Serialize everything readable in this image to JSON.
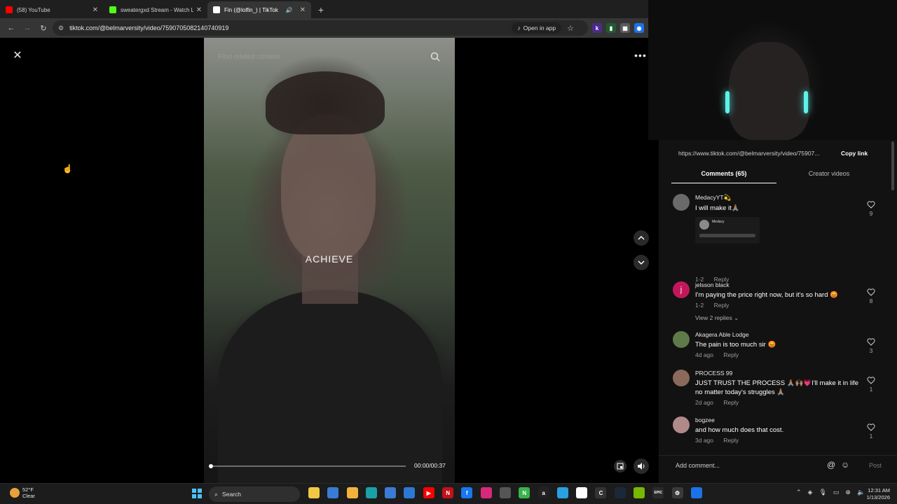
{
  "tabs": [
    {
      "title": "(58) YouTube",
      "close": "✕",
      "favicon_color": "#ff0000"
    },
    {
      "title": "sweatergxd Stream - Watch Live",
      "close": "✕",
      "favicon_color": "#53fc18"
    },
    {
      "title": "Fin (@lolfin_) | TikTok",
      "close": "✕",
      "favicon_color": "#ffffff",
      "active": true
    }
  ],
  "browser": {
    "url": "tiktok.com/@belmarversity/video/7590705082140740919",
    "open_in_app": "Open in app",
    "new_tab": "+",
    "back": "←",
    "forward": "→",
    "reload": "↻"
  },
  "video": {
    "search_placeholder": "Find related content",
    "caption": "ACHIEVE",
    "time": "00:00/00:37",
    "progress_fraction": 0.0,
    "close": "✕",
    "more": "•••"
  },
  "panel": {
    "link_url": "https://www.tiktok.com/@belmarversity/video/75907...",
    "copy_link": "Copy link",
    "tab_comments": "Comments (65)",
    "tab_creator": "Creator videos",
    "add_comment_placeholder": "Add comment...",
    "post": "Post",
    "reply_label": "Reply",
    "comments": [
      {
        "name": "MedacyYT💫",
        "text": "I will make it🙏🏽",
        "meta": "1-2",
        "likes": "9",
        "avatar_color": "#6a6a6a",
        "attachment_label": "Medacy"
      },
      {
        "name": "jelsson black",
        "text": "I'm paying the price right now, but it's so hard 😡",
        "meta": "1-2",
        "likes": "8",
        "avatar_color": "#c2185b",
        "avatar_letter": "j",
        "view_replies": "View 2 replies ⌄"
      },
      {
        "name": "Akagera Able Lodge",
        "text": "The pain is too much sir 😡",
        "meta": "4d ago",
        "likes": "3",
        "avatar_color": "#5e7a48"
      },
      {
        "name": "PROCESS 99",
        "text": "JUST TRUST THE PROCESS 🙏🏽🙌🏽💗I'll make it in life no matter today's struggles 🙏🏽",
        "meta": "2d ago",
        "likes": "1",
        "avatar_color": "#8a6a5a"
      },
      {
        "name": "bogzee",
        "text": "and how much does that cost.",
        "meta": "3d ago",
        "likes": "1",
        "avatar_color": "#b08a8a"
      }
    ]
  },
  "taskbar": {
    "temp": "52°F",
    "condition": "Clear",
    "search": "Search",
    "time": "12:31 AM",
    "date": "1/13/2026",
    "icons": [
      {
        "name": "file-explorer",
        "color": "#f2c744",
        "label": ""
      },
      {
        "name": "copilot",
        "color": "#3a7bd5",
        "label": ""
      },
      {
        "name": "folder",
        "color": "#f2b33d",
        "label": ""
      },
      {
        "name": "edge",
        "color": "#1aa0a8",
        "label": ""
      },
      {
        "name": "store",
        "color": "#3a7bd5",
        "label": ""
      },
      {
        "name": "outlook",
        "color": "#2c78d4",
        "label": ""
      },
      {
        "name": "youtube",
        "color": "#ff0000",
        "label": "▶"
      },
      {
        "name": "netflix",
        "color": "#c0121a",
        "label": "N"
      },
      {
        "name": "facebook",
        "color": "#1877f2",
        "label": "f"
      },
      {
        "name": "instagram",
        "color": "#d6297b",
        "label": ""
      },
      {
        "name": "calculator",
        "color": "#555555",
        "label": ""
      },
      {
        "name": "notion-green",
        "color": "#38b34a",
        "label": "N"
      },
      {
        "name": "amazon",
        "color": "#222222",
        "label": "a"
      },
      {
        "name": "app-blue",
        "color": "#2aa0e0",
        "label": ""
      },
      {
        "name": "roblox",
        "color": "#ffffff",
        "label": ""
      },
      {
        "name": "app-c",
        "color": "#333333",
        "label": "C"
      },
      {
        "name": "steam",
        "color": "#1b2838",
        "label": ""
      },
      {
        "name": "nvidia",
        "color": "#76b900",
        "label": ""
      },
      {
        "name": "epic",
        "color": "#2a2a2a",
        "label": "EPIC"
      },
      {
        "name": "settings",
        "color": "#3a3a3a",
        "label": "⚙"
      },
      {
        "name": "chrome",
        "color": "#1a73e8",
        "label": ""
      }
    ]
  }
}
